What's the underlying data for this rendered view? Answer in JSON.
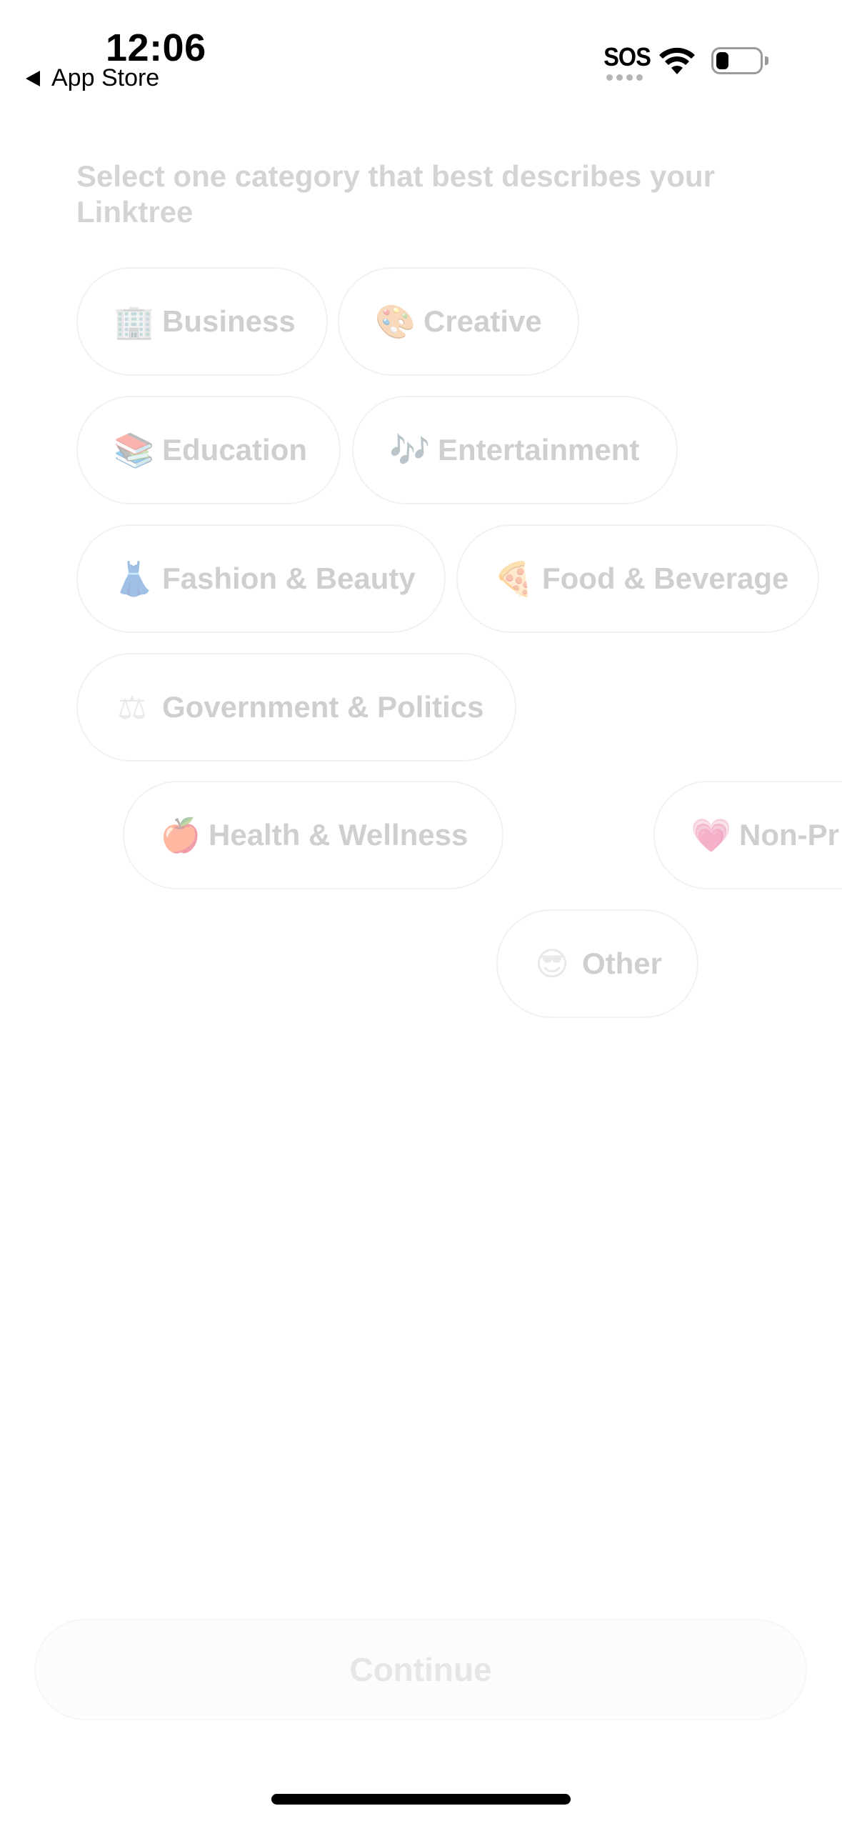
{
  "status_bar": {
    "time": "12:06",
    "back_app": "App Store",
    "sos": "SOS",
    "battery_level": 0.3
  },
  "heading": "Select one category that best describes your Linktree",
  "categories": [
    {
      "icon": "office-building-icon",
      "glyph": "🏢",
      "label": "Business"
    },
    {
      "icon": "artist-palette-icon",
      "glyph": "🎨",
      "label": "Creative"
    },
    {
      "icon": "books-icon",
      "glyph": "📚",
      "label": "Education"
    },
    {
      "icon": "musical-notes-icon",
      "glyph": "🎶",
      "label": "Entertainment"
    },
    {
      "icon": "dress-icon",
      "glyph": "👗",
      "label": "Fashion & Beauty"
    },
    {
      "icon": "pizza-icon",
      "glyph": "🍕",
      "label": "Food & Beverage"
    },
    {
      "icon": "balance-scale-icon",
      "glyph": "⚖",
      "label": "Government & Politics"
    },
    {
      "icon": "apple-icon",
      "glyph": "🍎",
      "label": "Health & Wellness"
    },
    {
      "icon": "heart-icon",
      "glyph": "💗",
      "label": "Non-Pr"
    },
    {
      "icon": "sunglasses-face-icon",
      "glyph": "😎",
      "label": "Other"
    }
  ],
  "continue_label": "Continue"
}
